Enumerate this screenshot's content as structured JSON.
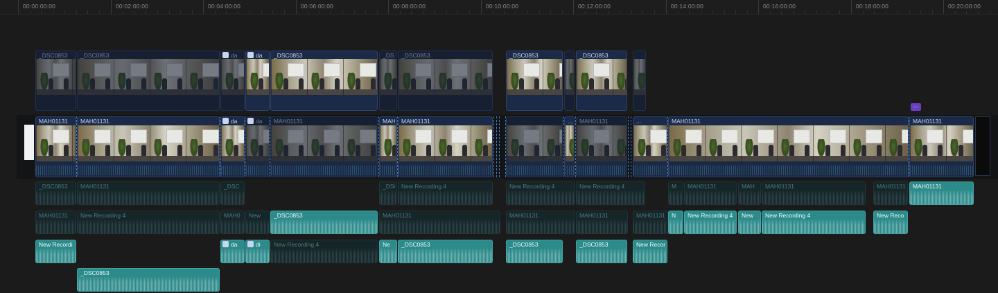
{
  "ruler": {
    "timecodes": [
      "00:00:00:00",
      "00:02:00:00",
      "00:04:00:00",
      "00:06:00:00",
      "00:08:00:00",
      "00:10:00:00",
      "00:12:00:00",
      "00:14:00:00",
      "00:16:00:00",
      "00:18:00:00",
      "00:20:00:00"
    ]
  },
  "marker": {
    "label": "..."
  },
  "colors": {
    "video": "#1b2a47",
    "audio": "#2c8a8a",
    "marker": "#6a3fbf",
    "background": "#1b1b1c"
  },
  "connected_video": [
    {
      "name": "_DSC0853",
      "dim": true
    },
    {
      "name": "_DSC0853",
      "dim": true
    },
    {
      "name": "da",
      "dim": true
    },
    {
      "name": "da",
      "dim": false
    },
    {
      "name": "_DSC0853",
      "dim": false
    },
    {
      "name": "_DS",
      "dim": true
    },
    {
      "name": "_DSC0853",
      "dim": true
    },
    {
      "name": "_DSC0853",
      "dim": false
    },
    {
      "name": "",
      "dim": true
    },
    {
      "name": "_DSC0853",
      "dim": false
    },
    {
      "name": "",
      "dim": true
    }
  ],
  "primary": [
    {
      "name": "MAH01131",
      "dim": false
    },
    {
      "name": "MAH01131",
      "dim": false
    },
    {
      "name": "da",
      "dim": false
    },
    {
      "name": "da",
      "dim": true
    },
    {
      "name": "MAH01131",
      "dim": true
    },
    {
      "name": "MAH",
      "dim": false
    },
    {
      "name": "MAH01131",
      "dim": false
    },
    {
      "name": "",
      "dim": true
    },
    {
      "name": "...",
      "dim": false
    },
    {
      "name": "MAH01131",
      "dim": true
    },
    {
      "name": "...",
      "dim": false
    },
    {
      "name": "MAH01131",
      "dim": false
    },
    {
      "name": "MAH01131",
      "dim": false
    }
  ],
  "audio_lane1": [
    {
      "name": "_DSC0853",
      "dim": true
    },
    {
      "name": "MAH01131",
      "dim": true
    },
    {
      "name": "_DSC",
      "dim": true
    },
    {
      "name": "_DSC",
      "dim": true
    },
    {
      "name": "New Recording 4",
      "dim": true
    },
    {
      "name": "New Recording 4",
      "dim": true
    },
    {
      "name": "New Recording 4",
      "dim": true
    },
    {
      "name": "M",
      "dim": true
    },
    {
      "name": "MAH01131",
      "dim": true
    },
    {
      "name": "MAH",
      "dim": true
    },
    {
      "name": "MAH01131",
      "dim": true
    },
    {
      "name": "MAH01131",
      "dim": true
    },
    {
      "name": "MAH01131",
      "dim": false
    }
  ],
  "audio_lane2": [
    {
      "name": "MAH01131",
      "dim": true
    },
    {
      "name": "New Recording 4",
      "dim": true
    },
    {
      "name": "MAH0",
      "dim": true
    },
    {
      "name": "New",
      "dim": true
    },
    {
      "name": "_DSC0853",
      "dim": false
    },
    {
      "name": "MAH01131",
      "dim": true
    },
    {
      "name": "MAH01131",
      "dim": true
    },
    {
      "name": "MAH01131",
      "dim": true
    },
    {
      "name": "MAH01131",
      "dim": true
    },
    {
      "name": "N",
      "dim": false
    },
    {
      "name": "New Recording 4",
      "dim": false
    },
    {
      "name": "New",
      "dim": false
    },
    {
      "name": "New Recording 4",
      "dim": false
    },
    {
      "name": "New Reco",
      "dim": false
    }
  ],
  "audio_lane3": [
    {
      "name": "New Recordi",
      "dim": false
    },
    {
      "name": "da",
      "dim": false
    },
    {
      "name": "di",
      "dim": false
    },
    {
      "name": "New Recording 4",
      "dim": true
    },
    {
      "name": "Ne",
      "dim": false
    },
    {
      "name": "_DSC0853",
      "dim": false
    },
    {
      "name": "_DSC0853",
      "dim": false
    },
    {
      "name": "_DSC0853",
      "dim": false
    },
    {
      "name": "New Recor",
      "dim": false
    }
  ],
  "audio_lane4": [
    {
      "name": "_DSC0853",
      "dim": false
    }
  ]
}
